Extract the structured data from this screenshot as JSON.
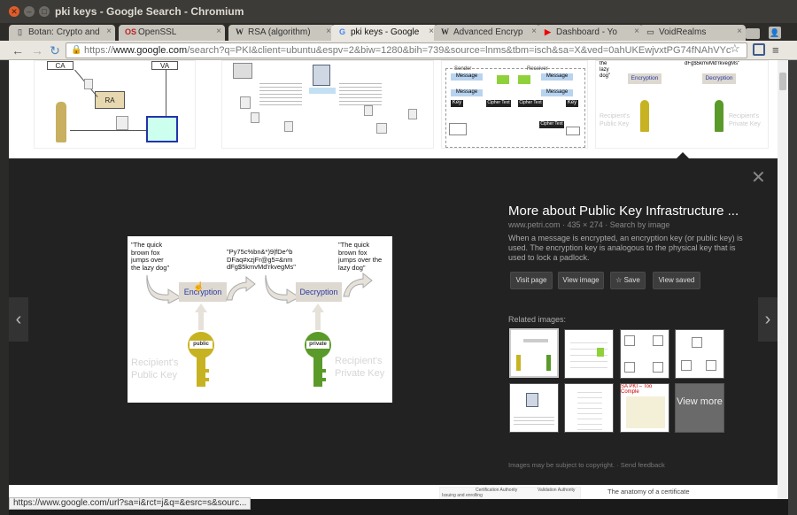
{
  "window": {
    "title": "pki keys - Google Search - Chromium",
    "close_glyph": "✕",
    "min_glyph": "–",
    "max_glyph": "□"
  },
  "tabs": [
    {
      "label": "Botan: Crypto and",
      "icon": "lock-icon",
      "active": false
    },
    {
      "label": "OpenSSL",
      "icon": "openssl-icon",
      "active": false
    },
    {
      "label": "RSA (algorithm)",
      "icon": "wikipedia-icon",
      "active": false
    },
    {
      "label": "pki keys - Google",
      "icon": "google-icon",
      "active": true
    },
    {
      "label": "Advanced Encryp",
      "icon": "wikipedia-icon",
      "active": false
    },
    {
      "label": "Dashboard - Yo",
      "icon": "youtube-icon",
      "active": false
    },
    {
      "label": "VoidRealms",
      "icon": "page-icon",
      "active": false
    }
  ],
  "tab_close_glyph": "×",
  "profile_glyph": "👤",
  "toolbar": {
    "back_glyph": "←",
    "forward_glyph": "→",
    "reload_glyph": "↻",
    "url_scheme": "https://",
    "url_host": "www.google.com",
    "url_path": "/search?q=PKI&client=ubuntu&espv=2&biw=1280&bih=739&source=lnms&tbm=isch&sa=X&ved=0ahUKEwjvxtPG74fNAhVYc",
    "star_glyph": "☆",
    "menu_glyph": "≡"
  },
  "thumb1": {
    "ca": "CA",
    "va": "VA",
    "ra": "RA"
  },
  "thumb3": {
    "sender": "Sender",
    "receiver": "Receiver",
    "message": "Message",
    "key": "Key",
    "cipher": "Cipher Text",
    "ptext": "PTEXT"
  },
  "thumb4": {
    "dog": "the lazy dog\"",
    "gibberish": "dFg$5kmvMd'rkvegMs\"",
    "encryption": "Encryption",
    "decryption": "Decryption",
    "recipients_public": "Recipient's Public Key",
    "recipients_private": "Recipient's Private Key"
  },
  "panel": {
    "close_glyph": "✕",
    "prev_glyph": "‹",
    "next_glyph": "›",
    "title": "More about Public Key Infrastructure ...",
    "meta": "www.petri.com · 435 × 274 · Search by image",
    "description": "When a message is encrypted, an encryption key (or public key) is used. The encryption key is analogous to the physical key that is used to lock a padlock.",
    "buttons": {
      "visit": "Visit page",
      "view_image": "View image",
      "save": "Save",
      "save_glyph": "☆",
      "view_saved": "View saved"
    },
    "related_label": "Related images:",
    "view_more": "View more",
    "footer_note": "Images may be subject to copyright. · Send feedback"
  },
  "main_image": {
    "quote_left": "\"The quick brown fox jumps over the lazy dog\"",
    "quote_middle": "\"Py75c%bn&*)9|fDe^b DFaq#xzjFr@g5=&nm dFg$5kmvMd'rkvegMs\"",
    "quote_right": "\"The quick brown fox jumps over the lazy dog\"",
    "encryption": "Encryption",
    "decryption": "Decryption",
    "public_tag": "public",
    "private_tag": "private",
    "recipients_public": "Recipient's Public Key",
    "recipients_private": "Recipient's Private Key"
  },
  "bottom_strip": {
    "caption": "The anatomy of a certificate",
    "cert_authority": "Certification Authority",
    "validation_authority": "Validation Authority",
    "issuing": "Issuing and enrolling"
  },
  "status_bar": {
    "url": "https://www.google.com/url?sa=i&rct=j&q=&esrc=s&sourc..."
  },
  "colors": {
    "panel_bg": "#222222",
    "link_blue": "#2a3aa0",
    "key_gold": "#c7b321",
    "key_green": "#5a9a2a"
  }
}
